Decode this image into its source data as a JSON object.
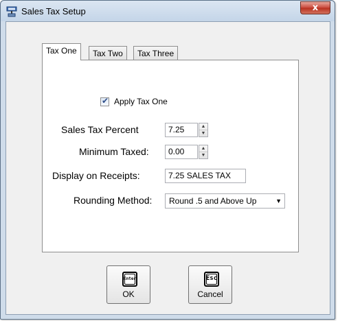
{
  "window": {
    "title": "Sales Tax Setup",
    "close_label": "x"
  },
  "tabs": [
    {
      "label": "Tax One",
      "active": true
    },
    {
      "label": "Tax Two",
      "active": false
    },
    {
      "label": "Tax Three",
      "active": false
    }
  ],
  "form": {
    "apply_tax": {
      "label": "Apply Tax One",
      "checked": true
    },
    "sales_tax_percent": {
      "label": "Sales Tax Percent",
      "value": "7.25"
    },
    "minimum_taxed": {
      "label": "Minimum Taxed:",
      "value": "0.00"
    },
    "display_on_receipts": {
      "label": "Display on Receipts:",
      "value": "7.25 SALES TAX"
    },
    "rounding_method": {
      "label": "Rounding Method:",
      "value": "Round .5 and Above Up"
    }
  },
  "buttons": {
    "ok": {
      "key": "Enter",
      "label": "OK"
    },
    "cancel": {
      "key": "Esc",
      "label": "Cancel"
    }
  },
  "icons": {
    "title": "register-icon",
    "close": "close-icon",
    "check": "checkmark-icon",
    "spin_up": "spin-up-icon",
    "spin_down": "spin-down-icon",
    "dropdown": "chevron-down-icon",
    "enter_key": "enter-key-icon",
    "esc_key": "esc-key-icon"
  },
  "colors": {
    "title_bar": "#c4d5e8",
    "close_button": "#c8473a",
    "client_bg": "#f0f0f0",
    "panel_bg": "#ffffff"
  }
}
